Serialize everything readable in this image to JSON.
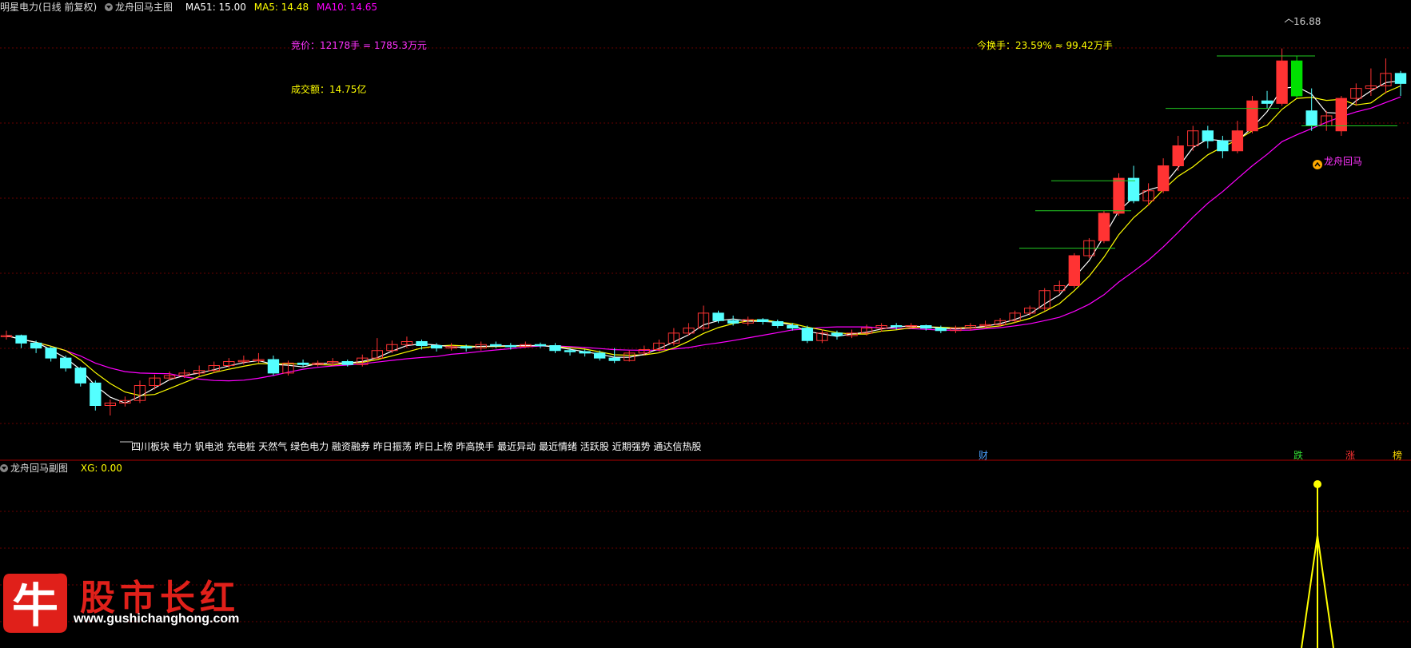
{
  "main_header": {
    "stock": "明星电力(日线 前复权)",
    "indicator": "龙舟回马主图",
    "ma51": "MA51: 15.00",
    "ma5": "MA5: 14.48",
    "ma10": "MA10: 14.65"
  },
  "annotations": {
    "bid": "竞价：12178手 = 1785.3万元",
    "turnover_today": "今换手：23.59% ≈ 99.42万手",
    "volume_amount": "成交额：14.75亿",
    "high_label": "16.88",
    "signal_label": "龙舟回马"
  },
  "concept_tags": "四川板块 电力 钒电池 充电桩 天然气 绿色电力  融资融券 昨日振荡 昨日上榜 昨高换手 最近异动 最近情绪 活跃股 近期强势 通达信热股",
  "bottom_marks": [
    {
      "text": "财",
      "color": "#4aa0ff"
    },
    {
      "text": "跌",
      "color": "#33dd33"
    },
    {
      "text": "涨",
      "color": "#ff3333"
    },
    {
      "text": "榜",
      "color": "#ffdd00"
    }
  ],
  "sub_header": {
    "indicator": "龙舟回马副图",
    "xg": "XG: 0.00"
  },
  "logo": {
    "char": "牛",
    "text": "股市长红",
    "url": "www.gushichanghong.com"
  },
  "colors": {
    "up": "#ff3333",
    "down": "#54ffff",
    "big_down": "#00e000",
    "ma_white": "#ffffff",
    "ma_yellow": "#ffff00",
    "ma_magenta": "#ff00ff",
    "grid": "#6a0000"
  },
  "chart_data": {
    "type": "candlestick",
    "title": "明星电力(日线 前复权)",
    "ylim": [
      8.4,
      17.2
    ],
    "candles": [
      [
        10.8,
        10.8,
        10.9,
        10.72
      ],
      [
        10.8,
        10.65,
        10.82,
        10.55
      ],
      [
        10.65,
        10.55,
        10.7,
        10.45
      ],
      [
        10.55,
        10.35,
        10.58,
        10.28
      ],
      [
        10.35,
        10.15,
        10.4,
        10.08
      ],
      [
        10.15,
        9.85,
        10.18,
        9.78
      ],
      [
        9.85,
        9.4,
        9.9,
        9.3
      ],
      [
        9.4,
        9.45,
        9.52,
        9.2
      ],
      [
        9.45,
        9.5,
        9.58,
        9.38
      ],
      [
        9.5,
        9.8,
        9.9,
        9.45
      ],
      [
        9.8,
        9.95,
        10.02,
        9.72
      ],
      [
        9.95,
        10.0,
        10.08,
        9.9
      ],
      [
        10.0,
        10.05,
        10.12,
        9.95
      ],
      [
        10.05,
        10.1,
        10.2,
        10.0
      ],
      [
        10.1,
        10.2,
        10.28,
        10.05
      ],
      [
        10.2,
        10.28,
        10.35,
        10.15
      ],
      [
        10.28,
        10.3,
        10.4,
        10.22
      ],
      [
        10.3,
        10.32,
        10.45,
        10.25
      ],
      [
        10.32,
        10.05,
        10.4,
        10.0
      ],
      [
        10.05,
        10.25,
        10.3,
        10.0
      ],
      [
        10.25,
        10.22,
        10.32,
        10.18
      ],
      [
        10.22,
        10.25,
        10.3,
        10.18
      ],
      [
        10.25,
        10.28,
        10.35,
        10.2
      ],
      [
        10.28,
        10.22,
        10.32,
        10.18
      ],
      [
        10.22,
        10.35,
        10.42,
        10.18
      ],
      [
        10.35,
        10.5,
        10.75,
        10.32
      ],
      [
        10.5,
        10.62,
        10.7,
        10.45
      ],
      [
        10.62,
        10.68,
        10.78,
        10.55
      ],
      [
        10.68,
        10.6,
        10.72,
        10.52
      ],
      [
        10.6,
        10.55,
        10.65,
        10.48
      ],
      [
        10.55,
        10.58,
        10.65,
        10.5
      ],
      [
        10.58,
        10.55,
        10.62,
        10.48
      ],
      [
        10.55,
        10.62,
        10.68,
        10.5
      ],
      [
        10.62,
        10.6,
        10.68,
        10.55
      ],
      [
        10.6,
        10.58,
        10.65,
        10.52
      ],
      [
        10.58,
        10.62,
        10.68,
        10.55
      ],
      [
        10.62,
        10.6,
        10.66,
        10.55
      ],
      [
        10.6,
        10.5,
        10.65,
        10.45
      ],
      [
        10.5,
        10.48,
        10.55,
        10.4
      ],
      [
        10.48,
        10.45,
        10.52,
        10.38
      ],
      [
        10.45,
        10.35,
        10.5,
        10.3
      ],
      [
        10.35,
        10.3,
        10.55,
        10.25
      ],
      [
        10.3,
        10.45,
        10.5,
        10.28
      ],
      [
        10.45,
        10.52,
        10.6,
        10.4
      ],
      [
        10.52,
        10.65,
        10.72,
        10.48
      ],
      [
        10.65,
        10.85,
        10.95,
        10.6
      ],
      [
        10.85,
        10.95,
        11.05,
        10.8
      ],
      [
        10.95,
        11.25,
        11.4,
        10.9
      ],
      [
        11.25,
        11.1,
        11.3,
        11.05
      ],
      [
        11.1,
        11.05,
        11.2,
        11.0
      ],
      [
        11.05,
        11.12,
        11.18,
        11.0
      ],
      [
        11.12,
        11.08,
        11.15,
        11.02
      ],
      [
        11.08,
        11.0,
        11.12,
        10.95
      ],
      [
        11.0,
        10.95,
        11.05,
        10.9
      ],
      [
        10.95,
        10.7,
        11.0,
        10.65
      ],
      [
        10.7,
        10.85,
        10.92,
        10.65
      ],
      [
        10.85,
        10.8,
        10.9,
        10.72
      ],
      [
        10.8,
        10.85,
        10.92,
        10.75
      ],
      [
        10.85,
        10.95,
        11.02,
        10.8
      ],
      [
        10.95,
        11.0,
        11.05,
        10.88
      ],
      [
        11.0,
        10.98,
        11.05,
        10.92
      ],
      [
        10.98,
        11.0,
        11.05,
        10.95
      ],
      [
        11.0,
        10.95,
        11.02,
        10.9
      ],
      [
        10.95,
        10.9,
        11.0,
        10.85
      ],
      [
        10.9,
        10.95,
        11.0,
        10.85
      ],
      [
        10.95,
        11.0,
        11.05,
        10.9
      ],
      [
        11.0,
        11.02,
        11.1,
        10.95
      ],
      [
        11.02,
        11.1,
        11.15,
        10.98
      ],
      [
        11.1,
        11.25,
        11.3,
        11.05
      ],
      [
        11.25,
        11.35,
        11.4,
        11.2
      ],
      [
        11.35,
        11.7,
        11.75,
        11.3
      ],
      [
        11.7,
        11.8,
        11.9,
        11.65
      ],
      [
        11.8,
        12.4,
        12.45,
        11.75
      ],
      [
        12.4,
        12.7,
        12.75,
        12.35
      ],
      [
        12.7,
        13.25,
        13.3,
        12.65
      ],
      [
        13.25,
        13.95,
        14.05,
        13.2
      ],
      [
        13.95,
        13.5,
        14.2,
        13.45
      ],
      [
        13.5,
        13.7,
        13.85,
        13.4
      ],
      [
        13.7,
        14.2,
        14.35,
        13.65
      ],
      [
        14.2,
        14.6,
        14.8,
        14.1
      ],
      [
        14.6,
        14.9,
        15.0,
        14.5
      ],
      [
        14.9,
        14.7,
        15.0,
        14.55
      ],
      [
        14.7,
        14.5,
        14.8,
        14.35
      ],
      [
        14.5,
        14.9,
        15.1,
        14.45
      ],
      [
        14.9,
        15.5,
        15.6,
        14.85
      ],
      [
        15.5,
        15.45,
        15.7,
        15.35
      ],
      [
        15.45,
        16.3,
        16.55,
        15.4
      ],
      [
        16.3,
        15.6,
        16.4,
        15.55
      ],
      [
        15.3,
        15.0,
        15.75,
        14.9
      ],
      [
        15.0,
        15.2,
        15.3,
        14.9
      ],
      [
        14.9,
        15.55,
        15.6,
        14.8
      ],
      [
        15.55,
        15.75,
        15.85,
        15.4
      ],
      [
        15.75,
        15.8,
        16.15,
        15.6
      ],
      [
        15.8,
        16.05,
        16.35,
        15.65
      ],
      [
        16.05,
        15.85,
        16.1,
        15.6
      ]
    ],
    "signal_xg": 0.0
  }
}
